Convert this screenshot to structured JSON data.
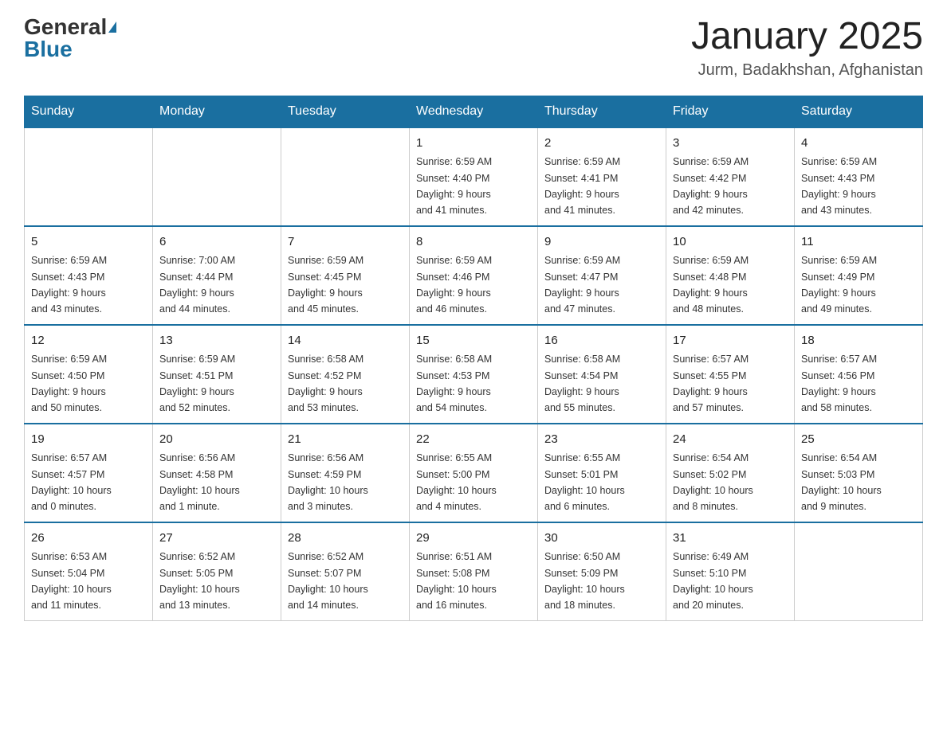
{
  "header": {
    "logo_general": "General",
    "logo_blue": "Blue",
    "title": "January 2025",
    "subtitle": "Jurm, Badakhshan, Afghanistan"
  },
  "calendar": {
    "days_of_week": [
      "Sunday",
      "Monday",
      "Tuesday",
      "Wednesday",
      "Thursday",
      "Friday",
      "Saturday"
    ],
    "weeks": [
      [
        {
          "day": "",
          "info": ""
        },
        {
          "day": "",
          "info": ""
        },
        {
          "day": "",
          "info": ""
        },
        {
          "day": "1",
          "info": "Sunrise: 6:59 AM\nSunset: 4:40 PM\nDaylight: 9 hours\nand 41 minutes."
        },
        {
          "day": "2",
          "info": "Sunrise: 6:59 AM\nSunset: 4:41 PM\nDaylight: 9 hours\nand 41 minutes."
        },
        {
          "day": "3",
          "info": "Sunrise: 6:59 AM\nSunset: 4:42 PM\nDaylight: 9 hours\nand 42 minutes."
        },
        {
          "day": "4",
          "info": "Sunrise: 6:59 AM\nSunset: 4:43 PM\nDaylight: 9 hours\nand 43 minutes."
        }
      ],
      [
        {
          "day": "5",
          "info": "Sunrise: 6:59 AM\nSunset: 4:43 PM\nDaylight: 9 hours\nand 43 minutes."
        },
        {
          "day": "6",
          "info": "Sunrise: 7:00 AM\nSunset: 4:44 PM\nDaylight: 9 hours\nand 44 minutes."
        },
        {
          "day": "7",
          "info": "Sunrise: 6:59 AM\nSunset: 4:45 PM\nDaylight: 9 hours\nand 45 minutes."
        },
        {
          "day": "8",
          "info": "Sunrise: 6:59 AM\nSunset: 4:46 PM\nDaylight: 9 hours\nand 46 minutes."
        },
        {
          "day": "9",
          "info": "Sunrise: 6:59 AM\nSunset: 4:47 PM\nDaylight: 9 hours\nand 47 minutes."
        },
        {
          "day": "10",
          "info": "Sunrise: 6:59 AM\nSunset: 4:48 PM\nDaylight: 9 hours\nand 48 minutes."
        },
        {
          "day": "11",
          "info": "Sunrise: 6:59 AM\nSunset: 4:49 PM\nDaylight: 9 hours\nand 49 minutes."
        }
      ],
      [
        {
          "day": "12",
          "info": "Sunrise: 6:59 AM\nSunset: 4:50 PM\nDaylight: 9 hours\nand 50 minutes."
        },
        {
          "day": "13",
          "info": "Sunrise: 6:59 AM\nSunset: 4:51 PM\nDaylight: 9 hours\nand 52 minutes."
        },
        {
          "day": "14",
          "info": "Sunrise: 6:58 AM\nSunset: 4:52 PM\nDaylight: 9 hours\nand 53 minutes."
        },
        {
          "day": "15",
          "info": "Sunrise: 6:58 AM\nSunset: 4:53 PM\nDaylight: 9 hours\nand 54 minutes."
        },
        {
          "day": "16",
          "info": "Sunrise: 6:58 AM\nSunset: 4:54 PM\nDaylight: 9 hours\nand 55 minutes."
        },
        {
          "day": "17",
          "info": "Sunrise: 6:57 AM\nSunset: 4:55 PM\nDaylight: 9 hours\nand 57 minutes."
        },
        {
          "day": "18",
          "info": "Sunrise: 6:57 AM\nSunset: 4:56 PM\nDaylight: 9 hours\nand 58 minutes."
        }
      ],
      [
        {
          "day": "19",
          "info": "Sunrise: 6:57 AM\nSunset: 4:57 PM\nDaylight: 10 hours\nand 0 minutes."
        },
        {
          "day": "20",
          "info": "Sunrise: 6:56 AM\nSunset: 4:58 PM\nDaylight: 10 hours\nand 1 minute."
        },
        {
          "day": "21",
          "info": "Sunrise: 6:56 AM\nSunset: 4:59 PM\nDaylight: 10 hours\nand 3 minutes."
        },
        {
          "day": "22",
          "info": "Sunrise: 6:55 AM\nSunset: 5:00 PM\nDaylight: 10 hours\nand 4 minutes."
        },
        {
          "day": "23",
          "info": "Sunrise: 6:55 AM\nSunset: 5:01 PM\nDaylight: 10 hours\nand 6 minutes."
        },
        {
          "day": "24",
          "info": "Sunrise: 6:54 AM\nSunset: 5:02 PM\nDaylight: 10 hours\nand 8 minutes."
        },
        {
          "day": "25",
          "info": "Sunrise: 6:54 AM\nSunset: 5:03 PM\nDaylight: 10 hours\nand 9 minutes."
        }
      ],
      [
        {
          "day": "26",
          "info": "Sunrise: 6:53 AM\nSunset: 5:04 PM\nDaylight: 10 hours\nand 11 minutes."
        },
        {
          "day": "27",
          "info": "Sunrise: 6:52 AM\nSunset: 5:05 PM\nDaylight: 10 hours\nand 13 minutes."
        },
        {
          "day": "28",
          "info": "Sunrise: 6:52 AM\nSunset: 5:07 PM\nDaylight: 10 hours\nand 14 minutes."
        },
        {
          "day": "29",
          "info": "Sunrise: 6:51 AM\nSunset: 5:08 PM\nDaylight: 10 hours\nand 16 minutes."
        },
        {
          "day": "30",
          "info": "Sunrise: 6:50 AM\nSunset: 5:09 PM\nDaylight: 10 hours\nand 18 minutes."
        },
        {
          "day": "31",
          "info": "Sunrise: 6:49 AM\nSunset: 5:10 PM\nDaylight: 10 hours\nand 20 minutes."
        },
        {
          "day": "",
          "info": ""
        }
      ]
    ]
  }
}
